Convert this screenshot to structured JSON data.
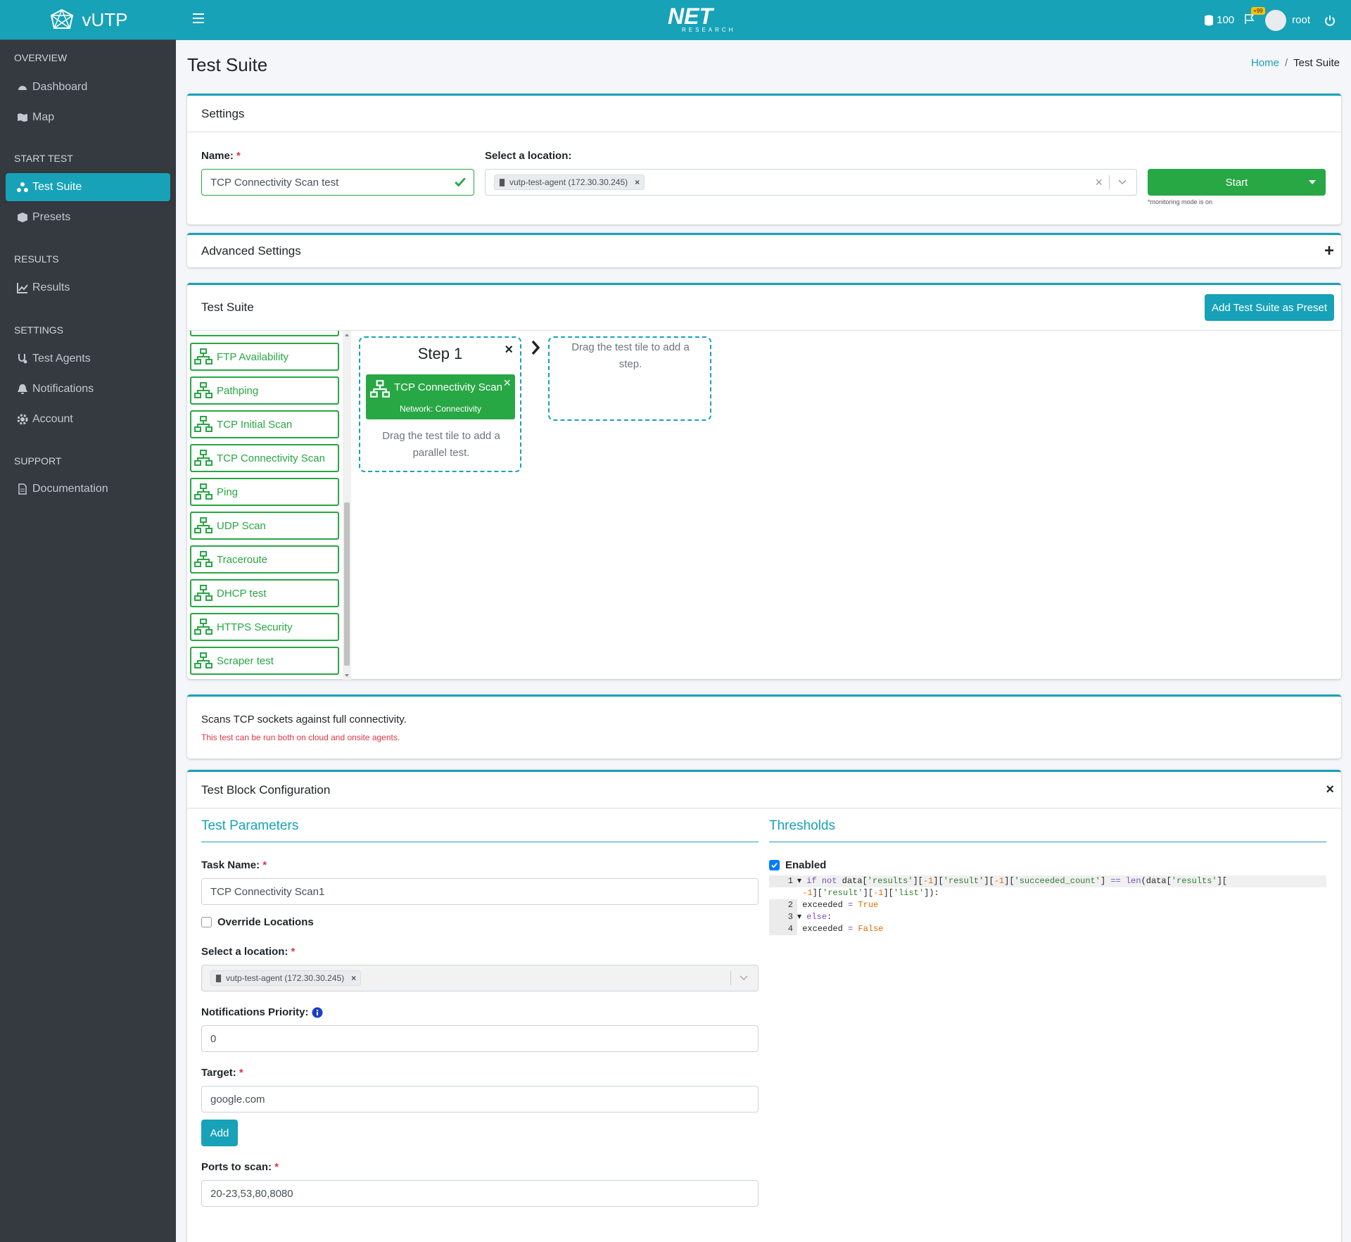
{
  "brand": {
    "name": "vUTP"
  },
  "topbar": {
    "logo_text": "NET",
    "logo_sub": "RESEARCH",
    "credits": "100",
    "flag_badge": "+99",
    "user": "root"
  },
  "sidebar": {
    "sections": [
      {
        "header": "OVERVIEW",
        "items": [
          {
            "label": "Dashboard",
            "icon": "dashboard-icon"
          },
          {
            "label": "Map",
            "icon": "map-icon"
          }
        ]
      },
      {
        "header": "START TEST",
        "items": [
          {
            "label": "Test Suite",
            "icon": "network-icon",
            "active": true
          },
          {
            "label": "Presets",
            "icon": "box-icon"
          }
        ]
      },
      {
        "header": "RESULTS",
        "items": [
          {
            "label": "Results",
            "icon": "chart-icon"
          }
        ]
      },
      {
        "header": "SETTINGS",
        "items": [
          {
            "label": "Test Agents",
            "icon": "stethoscope-icon"
          },
          {
            "label": "Notifications",
            "icon": "bell-icon"
          },
          {
            "label": "Account",
            "icon": "gear-icon"
          }
        ]
      },
      {
        "header": "SUPPORT",
        "items": [
          {
            "label": "Documentation",
            "icon": "file-icon"
          }
        ]
      }
    ]
  },
  "page": {
    "title": "Test Suite",
    "breadcrumb_home": "Home",
    "breadcrumb_sep": "/",
    "breadcrumb_current": "Test Suite"
  },
  "settings": {
    "header": "Settings",
    "name_label": "Name:",
    "name_req": "*",
    "name_value": "TCP Connectivity Scan test",
    "location_label": "Select a location:",
    "location_tag": "vutp-test-agent (172.30.30.245)",
    "start_label": "Start",
    "monitoring_note": "*monitoring mode is on"
  },
  "advanced": {
    "header": "Advanced Settings",
    "toggle": "+"
  },
  "suite": {
    "header": "Test Suite",
    "preset_button": "Add Test Suite as Preset",
    "tiles": [
      "FTP Availability",
      "Pathping",
      "TCP Initial Scan",
      "TCP Connectivity Scan",
      "Ping",
      "UDP Scan",
      "Traceroute",
      "DHCP test",
      "HTTPS Security",
      "Scraper test"
    ],
    "step_title": "Step 1",
    "step_test_name": "TCP Connectivity Scan",
    "step_test_category": "Network: Connectivity",
    "parallel_hint": "Drag the test tile to add a parallel test.",
    "step_hint": "Drag the test tile to add a step."
  },
  "description": {
    "text": "Scans TCP sockets against full connectivity.",
    "note": "This test can be run both on cloud and onsite agents."
  },
  "block": {
    "header": "Test Block Configuration",
    "params_title": "Test Parameters",
    "task_name_label": "Task Name:",
    "task_name_value": "TCP Connectivity Scan1",
    "override_label": "Override Locations",
    "location_label": "Select a location:",
    "location_tag": "vutp-test-agent (172.30.30.245)",
    "priority_label": "Notifications Priority:",
    "priority_value": "0",
    "target_label": "Target:",
    "target_value": "google.com",
    "add_label": "Add",
    "ports_label": "Ports to scan:",
    "ports_value": "20-23,53,80,8080",
    "thresholds_title": "Thresholds",
    "enabled_label": "Enabled",
    "code_lines": [
      "1",
      "2",
      "3",
      "4"
    ]
  },
  "colors": {
    "accent": "#17a2b8",
    "success": "#28a745",
    "danger": "#dc3545",
    "sidebar": "#343a40"
  }
}
